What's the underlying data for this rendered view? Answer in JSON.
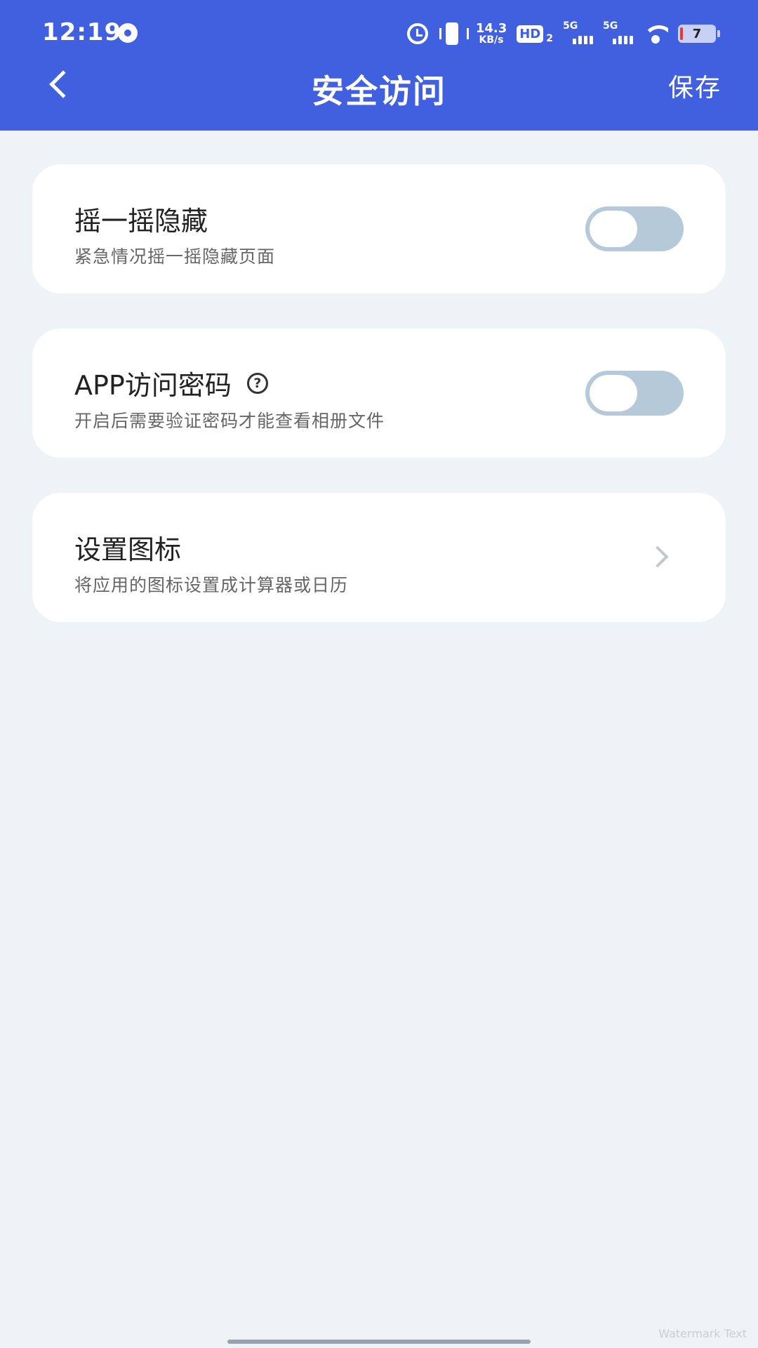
{
  "status_bar": {
    "time": "12:19",
    "speed_value": "14.3",
    "speed_unit": "KB/s",
    "hd_label": "HD",
    "hd_sub": "2",
    "sim1_label": "5G",
    "sim2_label": "5G",
    "battery": "7"
  },
  "header": {
    "title": "安全访问",
    "save_label": "保存"
  },
  "settings": [
    {
      "title": "摇一摇隐藏",
      "description": "紧急情况摇一摇隐藏页面",
      "control": "toggle",
      "enabled": false
    },
    {
      "title": "APP访问密码",
      "description": "开启后需要验证密码才能查看相册文件",
      "control": "toggle",
      "enabled": false,
      "help_icon_glyph": "?"
    },
    {
      "title": "设置图标",
      "description": "将应用的图标设置成计算器或日历",
      "control": "chevron"
    }
  ],
  "watermark": "Watermark Text",
  "colors": {
    "header_bg": "#4160df",
    "page_bg": "#eef3f8",
    "toggle_off": "#b6c9d9"
  }
}
